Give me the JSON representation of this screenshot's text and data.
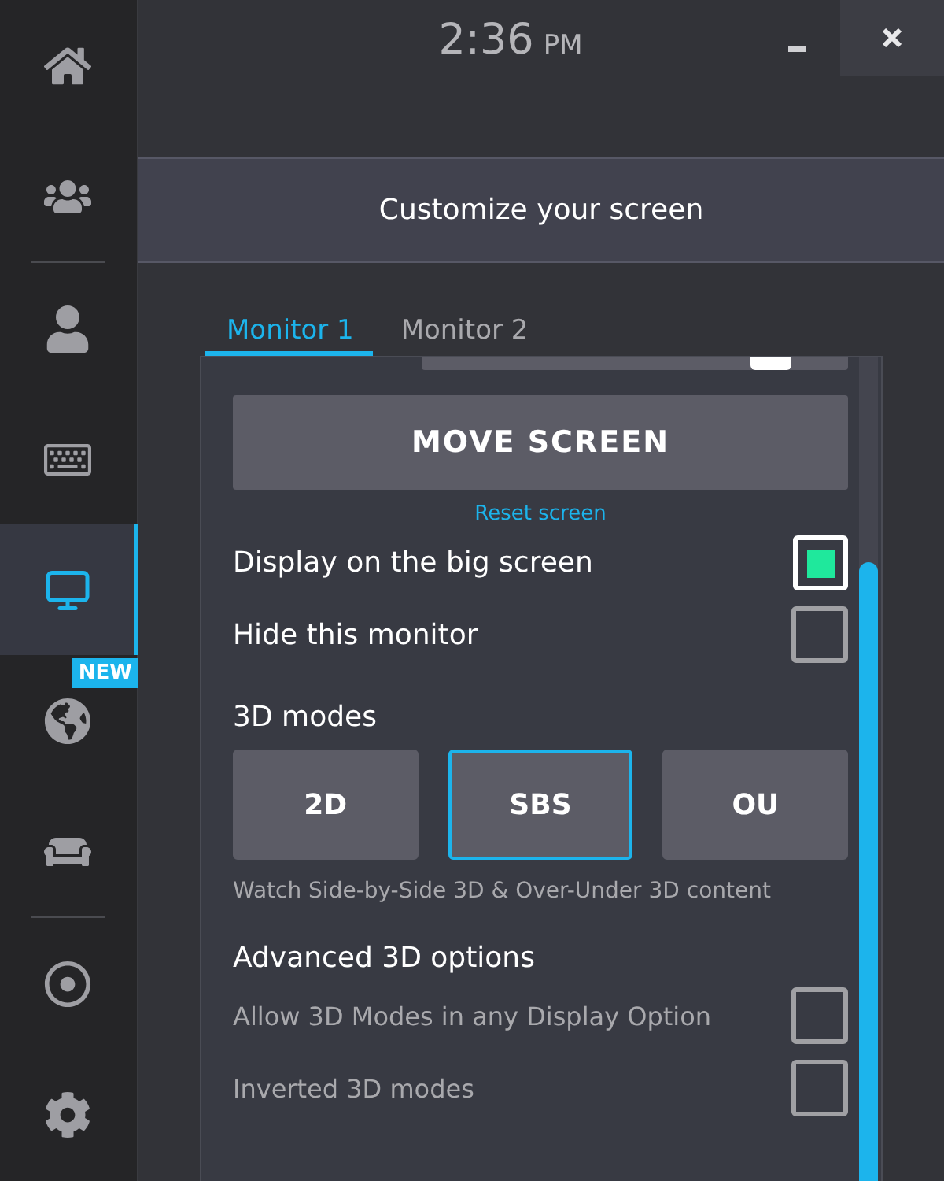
{
  "sidebar": {
    "groups": [
      {
        "items": [
          {
            "selected": false
          },
          {
            "selected": false
          }
        ]
      },
      {
        "items": [
          {
            "selected": false
          },
          {
            "selected": false
          },
          {
            "selected": true
          },
          {
            "selected": false,
            "badge": "NEW"
          },
          {
            "selected": false
          }
        ]
      },
      {
        "items": [
          {
            "selected": false
          },
          {
            "selected": false
          }
        ]
      }
    ]
  },
  "header": {
    "time": "2:36",
    "period": "PM"
  },
  "title": "Customize your screen",
  "tabs": [
    {
      "label": "Monitor 1",
      "selected": true
    },
    {
      "label": "Monitor 2",
      "selected": false
    }
  ],
  "brightness": {
    "level": 0.82
  },
  "move_button": "MOVE SCREEN",
  "reset_link": "Reset screen",
  "display_options": [
    {
      "label": "Display on the big screen",
      "checked": true
    },
    {
      "label": "Hide this monitor",
      "checked": false
    }
  ],
  "modes_heading": "3D modes",
  "modes": [
    {
      "label": "2D",
      "selected": false
    },
    {
      "label": "SBS",
      "selected": true
    },
    {
      "label": "OU",
      "selected": false
    }
  ],
  "modes_hint": "Watch Side-by-Side 3D & Over-Under 3D content",
  "advanced_heading": "Advanced 3D options",
  "advanced_options": [
    {
      "label": "Allow 3D Modes in any Display Option",
      "checked": false
    },
    {
      "label": "Inverted 3D modes",
      "checked": false
    }
  ]
}
